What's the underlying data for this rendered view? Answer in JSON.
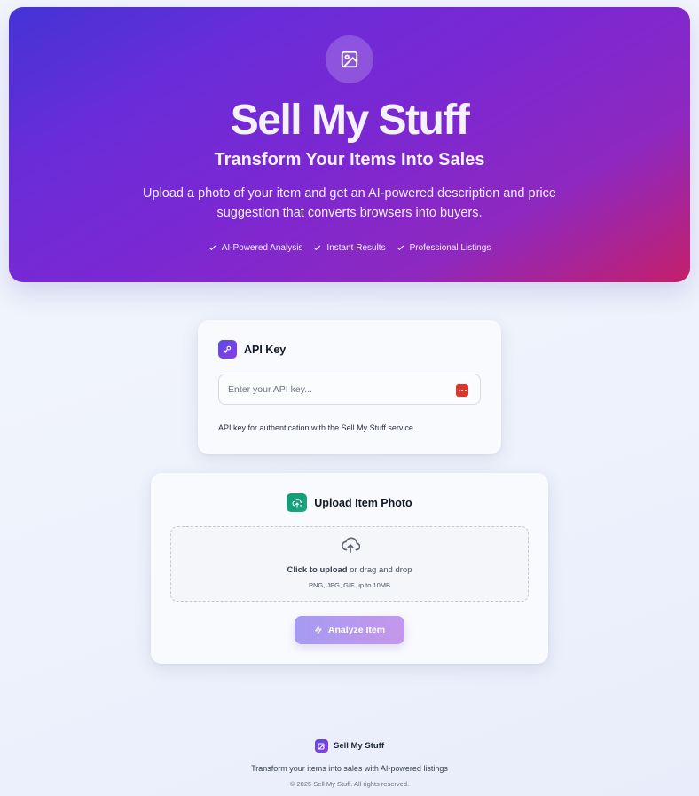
{
  "hero": {
    "icon": "image-icon",
    "title": "Sell My Stuff",
    "subtitle": "Transform Your Items Into Sales",
    "description": "Upload a photo of your item and get an AI-powered description and price suggestion that converts browsers into buyers.",
    "features": [
      "AI-Powered Analysis",
      "Instant Results",
      "Professional Listings"
    ],
    "gradient_colors": [
      "#4434d6",
      "#7b28d2",
      "#c41f6a"
    ]
  },
  "api_card": {
    "icon": "key-icon",
    "title": "API Key",
    "input_placeholder": "Enter your API key...",
    "input_value": "",
    "input_action_icon": "more-dots-icon",
    "help_text": "API key for authentication with the Sell My Stuff service."
  },
  "upload_card": {
    "icon": "upload-cloud-icon",
    "title": "Upload Item Photo",
    "dropzone": {
      "icon": "upload-cloud-icon",
      "click_text": "Click to upload",
      "rest_text": " or drag and drop",
      "hint": "PNG, JPG, GIF up to 10MB"
    },
    "analyze_button": {
      "icon": "lightning-icon",
      "label": "Analyze Item",
      "disabled": true
    }
  },
  "footer": {
    "brand": "Sell My Stuff",
    "tagline": "Transform your items into sales with AI-powered listings",
    "copyright": "© 2025 Sell My Stuff. All rights reserved."
  },
  "colors": {
    "accent_purple": "#6a3de0",
    "accent_green": "#129b74",
    "danger_red": "#e0342b"
  }
}
